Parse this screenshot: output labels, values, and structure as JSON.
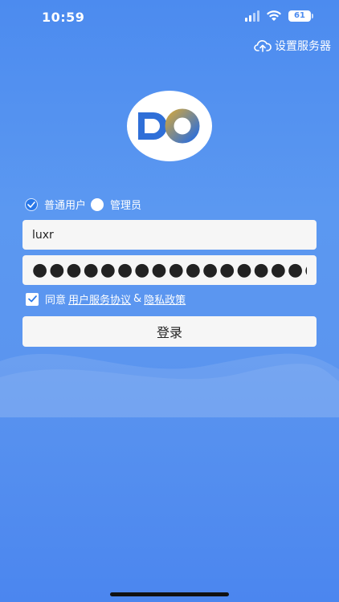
{
  "status_bar": {
    "time": "10:59",
    "battery": "61"
  },
  "header": {
    "server_settings_label": "设置服务器",
    "server_icon": "cloud-upload-icon"
  },
  "logo": {
    "text": "DO"
  },
  "roles": [
    {
      "label": "普通用户",
      "selected": true
    },
    {
      "label": "管理员",
      "selected": false
    }
  ],
  "form": {
    "username_value": "luxr",
    "password_value": "●●●●●●●●●●●●●●●●●●●●"
  },
  "agreement": {
    "checked": true,
    "prefix": "同意",
    "terms_link": "用户服务协议",
    "separator": "&",
    "privacy_link": "隐私政策"
  },
  "login_button_label": "登录",
  "colors": {
    "background": "#4c8bef",
    "accent": "#2a78e8",
    "field": "#f6f6f6"
  }
}
